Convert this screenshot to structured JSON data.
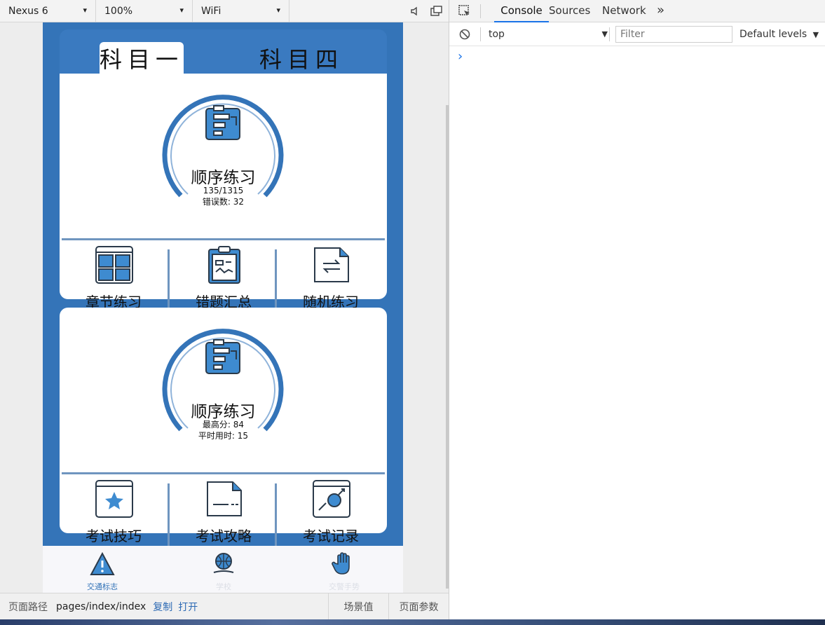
{
  "sim_toolbar": {
    "device": "Nexus 6",
    "zoom": "100%",
    "network": "WiFi",
    "chevron": "⌄"
  },
  "subject_tabs": [
    "科目一",
    "科目四"
  ],
  "card1": {
    "title": "顺序练习",
    "line1": "135/1315",
    "line2": "错误数: 32",
    "grid": [
      "章节练习",
      "错题汇总",
      "随机练习"
    ]
  },
  "card2": {
    "title": "顺序练习",
    "line1": "最高分: 84",
    "line2": "平时用时: 15",
    "grid": [
      "考试技巧",
      "考试攻略",
      "考试记录"
    ]
  },
  "tabbar": {
    "items": [
      {
        "label": "交通标志"
      },
      {
        "label": "学校"
      },
      {
        "label": "交警手势"
      }
    ]
  },
  "path_bar": {
    "label": "页面路径",
    "path": "pages/index/index",
    "copy": "复制",
    "open": "打开",
    "scene": "场景值",
    "params": "页面参数"
  },
  "devtools": {
    "tabs": [
      "Console",
      "Sources",
      "Network"
    ],
    "more": "»",
    "context": "top",
    "filter_placeholder": "Filter",
    "levels": "Default levels",
    "prompt": "›"
  },
  "colors": {
    "brand": "#3474b8",
    "accent": "#1a73e8"
  }
}
